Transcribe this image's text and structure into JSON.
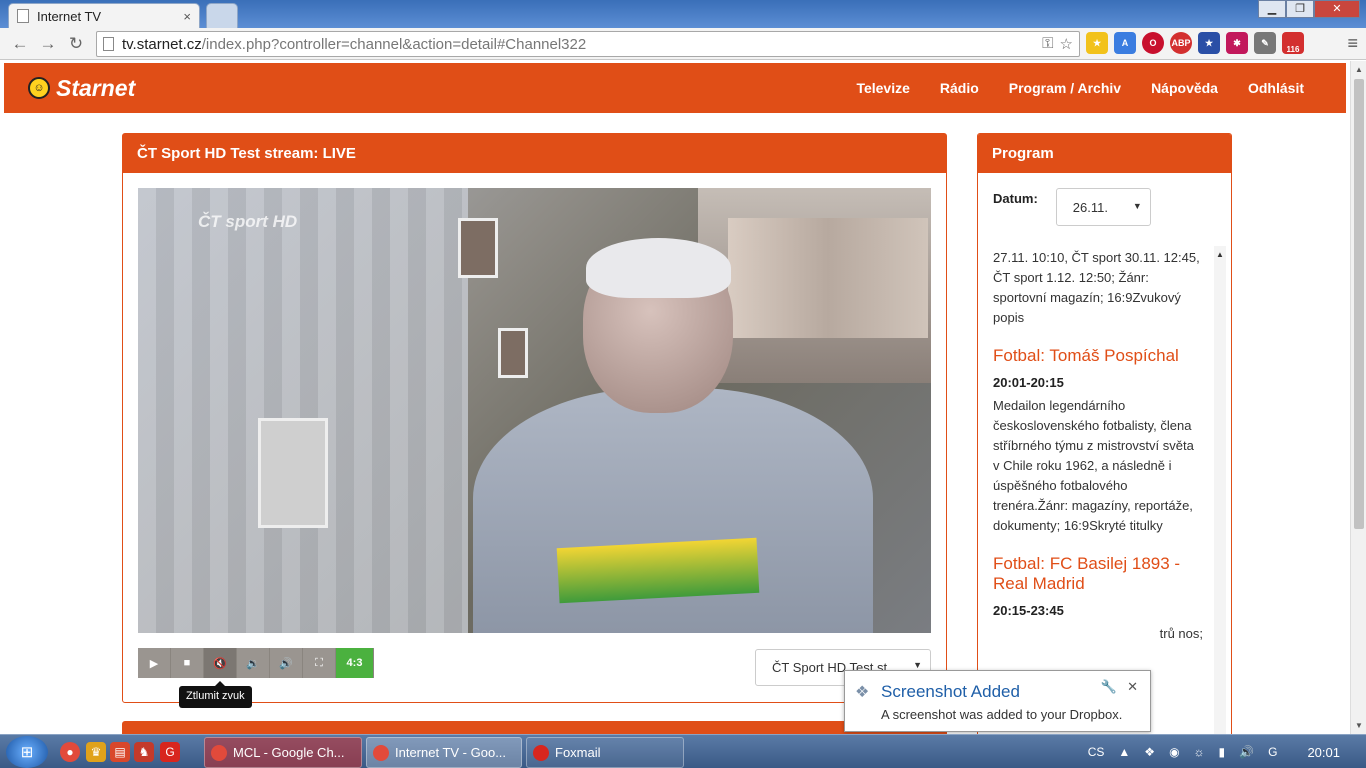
{
  "browser": {
    "tab_title": "Internet TV",
    "tab_close": "×",
    "url_host": "tv.starnet.cz",
    "url_path": "/index.php?controller=channel&action=detail#Channel322",
    "extension_badge": "116",
    "ext_abp": "ABP"
  },
  "site": {
    "logo_text": "Starnet",
    "nav": [
      "Televize",
      "Rádio",
      "Program / Archiv",
      "Nápověda",
      "Odhlásit"
    ]
  },
  "player": {
    "title": "ČT Sport HD Test stream: LIVE",
    "ratio_label": "4:3",
    "tooltip": "Ztlumit zvuk",
    "channel_select": "ČT Sport HD Test st"
  },
  "program": {
    "title": "Program",
    "date_label": "Datum:",
    "date_value": "26.11.",
    "intro_desc": "27.11. 10:10, ČT sport 30.11. 12:45, ČT sport 1.12. 12:50; Žánr: sportovní magazín; 16:9Zvukový popis",
    "items": [
      {
        "title": "Fotbal: Tomáš Pospíchal",
        "time": "20:01-20:15",
        "desc": "Medailon legendárního československého fotbalisty, člena stříbrného týmu z mistrovství světa v Chile roku 1962, a následně i úspěšného fotbalového trenéra.Žánr: magazíny, reportáže, dokumenty; 16:9Skryté titulky"
      },
      {
        "title": "Fotbal: FC Basilej 1893 - Real Madrid",
        "time": "20:15-23:45",
        "desc": "trů nos;"
      }
    ]
  },
  "notification": {
    "title": "Screenshot Added",
    "body": "A screenshot was added to your Dropbox."
  },
  "taskbar": {
    "tasks": [
      "MCL - Google Ch...",
      "Internet TV - Goo...",
      "Foxmail"
    ],
    "lang": "CS",
    "clock": "20:01"
  },
  "colors": {
    "brand": "#e04e17",
    "ratio_green": "#4bb13f",
    "link_blue": "#1f5fa8"
  }
}
